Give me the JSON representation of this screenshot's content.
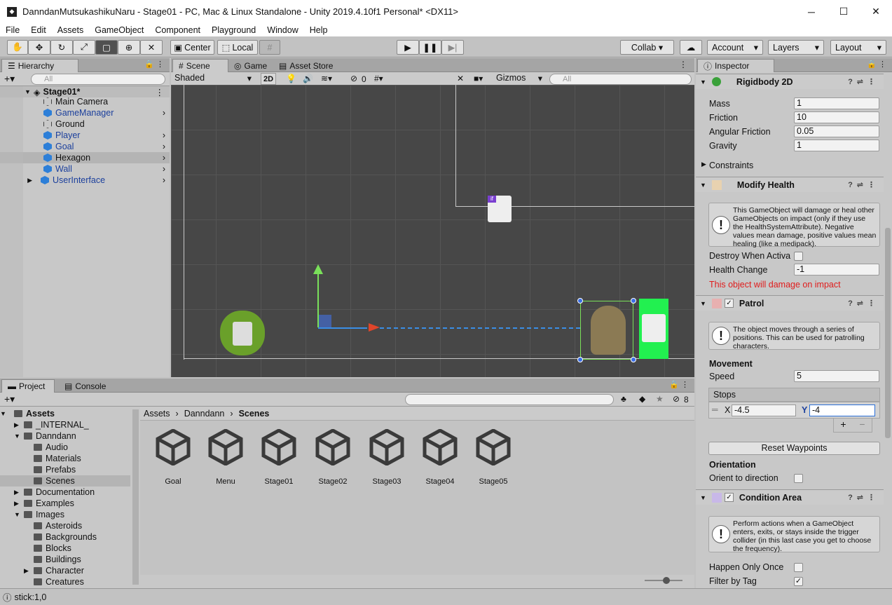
{
  "window": {
    "title": "DanndanMutsukashikuNaru - Stage01 - PC, Mac & Linux Standalone - Unity 2019.4.10f1 Personal* <DX11>",
    "minimize": "─",
    "maximize": "☐",
    "close": "✕"
  },
  "menu": [
    "File",
    "Edit",
    "Assets",
    "GameObject",
    "Component",
    "Playground",
    "Window",
    "Help"
  ],
  "toolbar": {
    "pivot_label": "Center",
    "space_label": "Local",
    "collab_label": "Collab ▾",
    "account_label": "Account",
    "layers_label": "Layers",
    "layout_label": "Layout"
  },
  "hierarchy": {
    "tab": "Hierarchy",
    "search_placeholder": "All",
    "scene_name": "Stage01*",
    "items": [
      {
        "label": "Main Camera",
        "prefab": false
      },
      {
        "label": "GameManager",
        "prefab": true
      },
      {
        "label": "Ground",
        "prefab": false
      },
      {
        "label": "Player",
        "prefab": true
      },
      {
        "label": "Goal",
        "prefab": true
      },
      {
        "label": "Hexagon",
        "prefab": false
      },
      {
        "label": "Wall",
        "prefab": true
      },
      {
        "label": "UserInterface",
        "prefab": true
      }
    ]
  },
  "scene_panel": {
    "tabs": [
      "Scene",
      "Game",
      "Asset Store"
    ],
    "shading": "Shaded",
    "mode_2d": "2D",
    "hidden_count": "0",
    "gizmos": "Gizmos",
    "search_placeholder": "All"
  },
  "project": {
    "tabs": [
      "Project",
      "Console"
    ],
    "breadcrumb": [
      "Assets",
      "Danndann",
      "Scenes"
    ],
    "hidden_count": "8",
    "tree": [
      {
        "label": "Assets",
        "depth": 0,
        "expanded": true,
        "bold": true
      },
      {
        "label": "_INTERNAL_",
        "depth": 1,
        "expanded": false
      },
      {
        "label": "Danndann",
        "depth": 1,
        "expanded": true
      },
      {
        "label": "Audio",
        "depth": 2
      },
      {
        "label": "Materials",
        "depth": 2
      },
      {
        "label": "Prefabs",
        "depth": 2
      },
      {
        "label": "Scenes",
        "depth": 2,
        "selected": true
      },
      {
        "label": "Documentation",
        "depth": 1,
        "expanded": false
      },
      {
        "label": "Examples",
        "depth": 1,
        "expanded": false
      },
      {
        "label": "Images",
        "depth": 1,
        "expanded": true
      },
      {
        "label": "Asteroids",
        "depth": 2
      },
      {
        "label": "Backgrounds",
        "depth": 2
      },
      {
        "label": "Blocks",
        "depth": 2
      },
      {
        "label": "Buildings",
        "depth": 2
      },
      {
        "label": "Character",
        "depth": 2,
        "expanded": false
      },
      {
        "label": "Creatures",
        "depth": 2
      }
    ],
    "scenes": [
      "Goal",
      "Menu",
      "Stage01",
      "Stage02",
      "Stage03",
      "Stage04",
      "Stage05"
    ]
  },
  "inspector": {
    "tab": "Inspector",
    "rigidbody": {
      "title": "Rigidbody 2D",
      "mass_label": "Mass",
      "mass": "1",
      "friction_label": "Friction",
      "friction": "10",
      "angular_label": "Angular Friction",
      "angular": "0.05",
      "gravity_label": "Gravity",
      "gravity": "1",
      "constraints": "Constraints"
    },
    "modify_health": {
      "title": "Modify Health",
      "help": "This GameObject will damage or heal other GameObjects on impact (only if they use the HealthSystemAttribute). Negative values mean damage, positive values mean healing (like a medipack).",
      "destroy_label": "Destroy When Activa",
      "health_label": "Health Change",
      "health_value": "-1",
      "warning": "This object will damage on impact"
    },
    "patrol": {
      "title": "Patrol",
      "help": "The object moves through a series of positions. This can be used for patrolling characters.",
      "movement": "Movement",
      "speed_label": "Speed",
      "speed": "5",
      "stops": "Stops",
      "x_label": "X",
      "x_value": "-4.5",
      "y_label": "Y",
      "y_value": "-4",
      "add": "+",
      "remove": "−",
      "reset": "Reset Waypoints",
      "orientation": "Orientation",
      "orient_label": "Orient to direction"
    },
    "condition_area": {
      "title": "Condition Area",
      "help": "Perform actions when a GameObject enters, exits, or stays inside the trigger collider (in this last case you get to choose the frequency).",
      "happen_label": "Happen Only Once",
      "filter_label": "Filter by Tag"
    }
  },
  "status": "stick:1,0"
}
